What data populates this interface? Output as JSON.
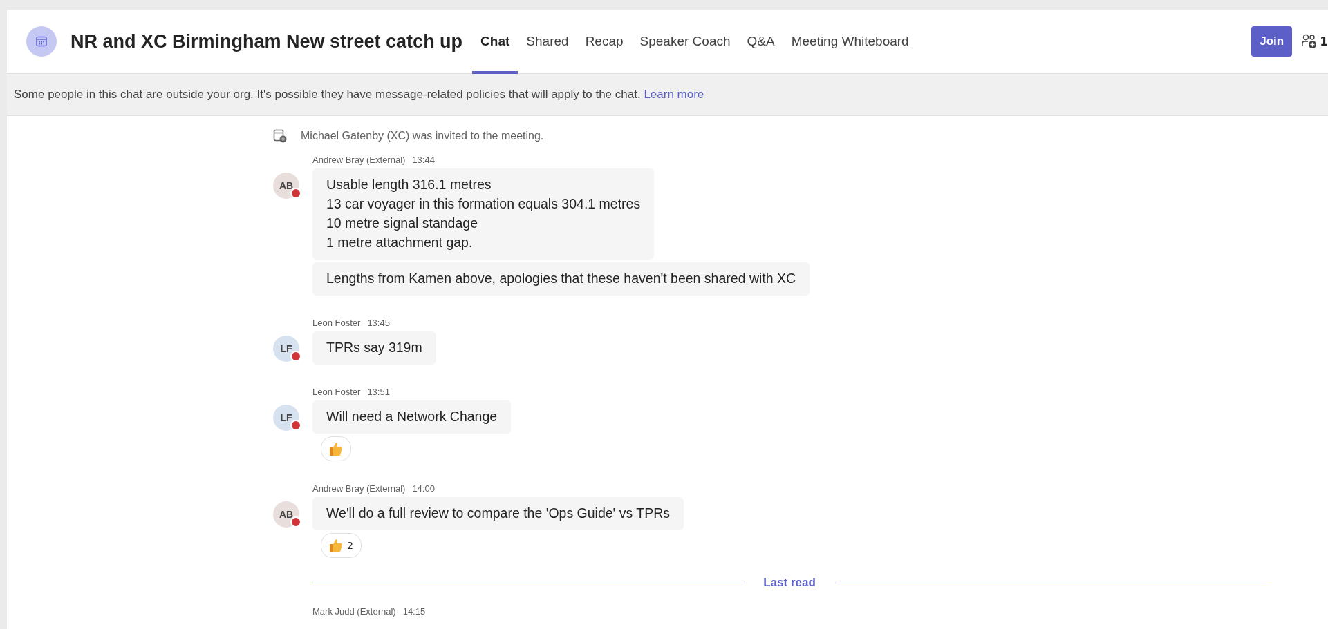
{
  "header": {
    "title": "NR and XC Birmingham New street catch up",
    "tabs": [
      {
        "label": "Chat",
        "selected": true
      },
      {
        "label": "Shared",
        "selected": false
      },
      {
        "label": "Recap",
        "selected": false
      },
      {
        "label": "Speaker Coach",
        "selected": false
      },
      {
        "label": "Q&A",
        "selected": false
      },
      {
        "label": "Meeting Whiteboard",
        "selected": false
      }
    ],
    "join_button": "Join",
    "participant_count": "1"
  },
  "banner": {
    "text": "Some people in this chat are outside your org. It's possible they have message-related policies that will apply to the chat.",
    "link": "Learn more"
  },
  "messages": [
    {
      "kind": "system",
      "text": "Michael Gatenby (XC) was invited to the meeting."
    },
    {
      "kind": "group",
      "author": "Andrew Bray (External)",
      "time": "13:44",
      "initials": "AB",
      "color": "#e8dedb",
      "busy": true,
      "bubbles": [
        {
          "lines": [
            "Usable length 316.1 metres",
            "13 car voyager in this formation equals 304.1 metres",
            "10 metre signal standage",
            "1 metre attachment gap."
          ]
        },
        {
          "lines": [
            "Lengths from Kamen above, apologies that these haven't been shared with XC"
          ]
        }
      ]
    },
    {
      "kind": "group",
      "author": "Leon Foster",
      "time": "13:45",
      "initials": "LF",
      "color": "#d6e2f0",
      "busy": true,
      "bubbles": [
        {
          "lines": [
            "TPRs say 319m"
          ]
        }
      ]
    },
    {
      "kind": "group",
      "author": "Leon Foster",
      "time": "13:51",
      "initials": "LF",
      "color": "#d6e2f0",
      "busy": true,
      "bubbles": [
        {
          "lines": [
            "Will need a Network Change"
          ]
        }
      ],
      "reactions": [
        {
          "kind": "thumbs_up"
        }
      ]
    },
    {
      "kind": "group",
      "author": "Andrew Bray (External)",
      "time": "14:00",
      "initials": "AB",
      "color": "#e8dedb",
      "busy": true,
      "bubbles": [
        {
          "lines": [
            "We'll do a full review to compare the 'Ops Guide' vs TPRs"
          ]
        }
      ],
      "reactions": [
        {
          "kind": "thumbs_up",
          "count": "2"
        }
      ]
    },
    {
      "kind": "divider",
      "text": "Last read"
    },
    {
      "kind": "author_only",
      "author": "Mark Judd (External)",
      "time": "14:15"
    }
  ]
}
